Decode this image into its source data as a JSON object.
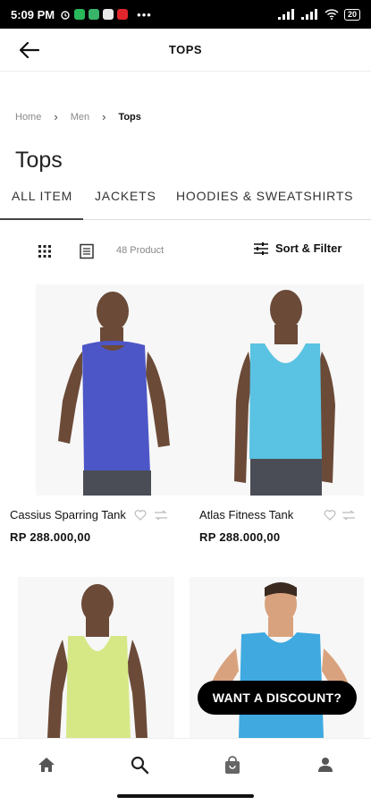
{
  "status_bar": {
    "time": "5:09 PM",
    "battery": "20"
  },
  "header": {
    "title": "TOPS"
  },
  "breadcrumb": [
    {
      "label": "Home"
    },
    {
      "label": "Men"
    },
    {
      "label": "Tops"
    }
  ],
  "page_title": "Tops",
  "tabs": [
    {
      "label": "ALL ITEM",
      "active": true
    },
    {
      "label": "JACKETS",
      "active": false
    },
    {
      "label": "HOODIES & SWEATSHIRTS",
      "active": false
    }
  ],
  "toolbar": {
    "product_count": "48 Product",
    "sort_filter_label": "Sort & Filter"
  },
  "products": [
    {
      "name": "Cassius Sparring Tank",
      "price": "RP 288.000,00",
      "shirt_color": "#4d56c6"
    },
    {
      "name": "Atlas Fitness Tank",
      "price": "RP 288.000,00",
      "shirt_color": "#5ac2e2"
    },
    {
      "name": "",
      "price": "",
      "shirt_color": "#d6e886"
    },
    {
      "name": "",
      "price": "",
      "shirt_color": "#3fa9e0"
    }
  ],
  "discount_button": {
    "label": "WANT A DISCOUNT?"
  },
  "bottom_nav": [
    {
      "icon": "home-icon"
    },
    {
      "icon": "search-icon"
    },
    {
      "icon": "shopping-bag-icon"
    },
    {
      "icon": "account-icon"
    }
  ],
  "colors": {
    "accent": "#000000",
    "skin": "#6b4a38"
  }
}
